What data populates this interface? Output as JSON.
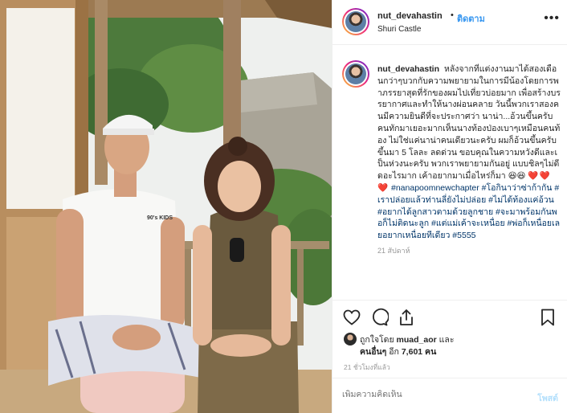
{
  "post": {
    "photo_alt": "Couple sitting on a wooden veranda at Shuri Castle",
    "tshirt_print": "90's KIDS"
  },
  "header": {
    "username": "nut_devahastin",
    "dot": "•",
    "follow_label": "ติดตาม",
    "location": "Shuri Castle",
    "more_label": "•••"
  },
  "caption": {
    "username": "nut_devahastin",
    "text": "หลังจากที่แต่งงานมาได้สองเดือนกว่าๆบวกกับความพยายามในการมีน้องโดยการพาภรรยาสุดที่รักของผมไปเที่ยวบ่อยมาก เพื่อสร้างบรรยากาศและทำให้นางผ่อนคลาย วันนี้พวกเราสองคนมีความยินดีที่จะประกาศว่า นาน่า...อ้วนขึ้นครับ คนทักมาเยอะมากเห็นนางท้องป่องเบาๆเหมือนคนท้อง ไม่ใช่แค่นาน่าคนเดียวนะครับ ผมก็อ้วนขึ้นครับ ขึ้นมา 5 โลละ ลดด่วน ขอบคุณในความหวังดีและเป็นห่วงนะครับ พวกเราพยายามกันอยู่ แบบชิลๆไม่ดีดอะไรมาก เค้าอยากมาเมื่อไหร่ก็มา 😆😆",
    "hearts": "❤️❤️❤️",
    "hashtags": "#nanapoomnewchapter #โอกินาว่าซ่าก้ากัน #เราปล่อยแล้วท่านลี่ยังไม่ปล่อย #ไม่ได้ท้องแค่อ้วน #อยากได้ลูกสาวตามด้วยลูกชาย #จะมาพร้อมกันพอก็ไม่ติดนะลูก #แต่แม่เค้าจะเหนื่อย #พ่อก็เหนื่อยเลยอยากเหนื่อยทีเดียว #5555",
    "time": "21 สัปดาห์"
  },
  "actions": {
    "like": "heart-icon",
    "comment": "comment-icon",
    "share": "share-icon",
    "save": "bookmark-icon"
  },
  "likes": {
    "prefix": "ถูกใจโดย",
    "first_user": "muad_aor",
    "and": "และ",
    "others_label": "คนอื่นๆ",
    "others_prefix": "อีก",
    "count": "7,601",
    "suffix": "คน"
  },
  "posted_ago": "21 ชั่วโมงที่แล้ว",
  "comment_box": {
    "placeholder": "เพิ่มความคิดเห็น",
    "post_label": "โพสต์"
  },
  "colors": {
    "link_blue": "#3897f0",
    "post_disabled": "#b2dffc",
    "hashtag": "#003569",
    "border": "#efefef"
  }
}
